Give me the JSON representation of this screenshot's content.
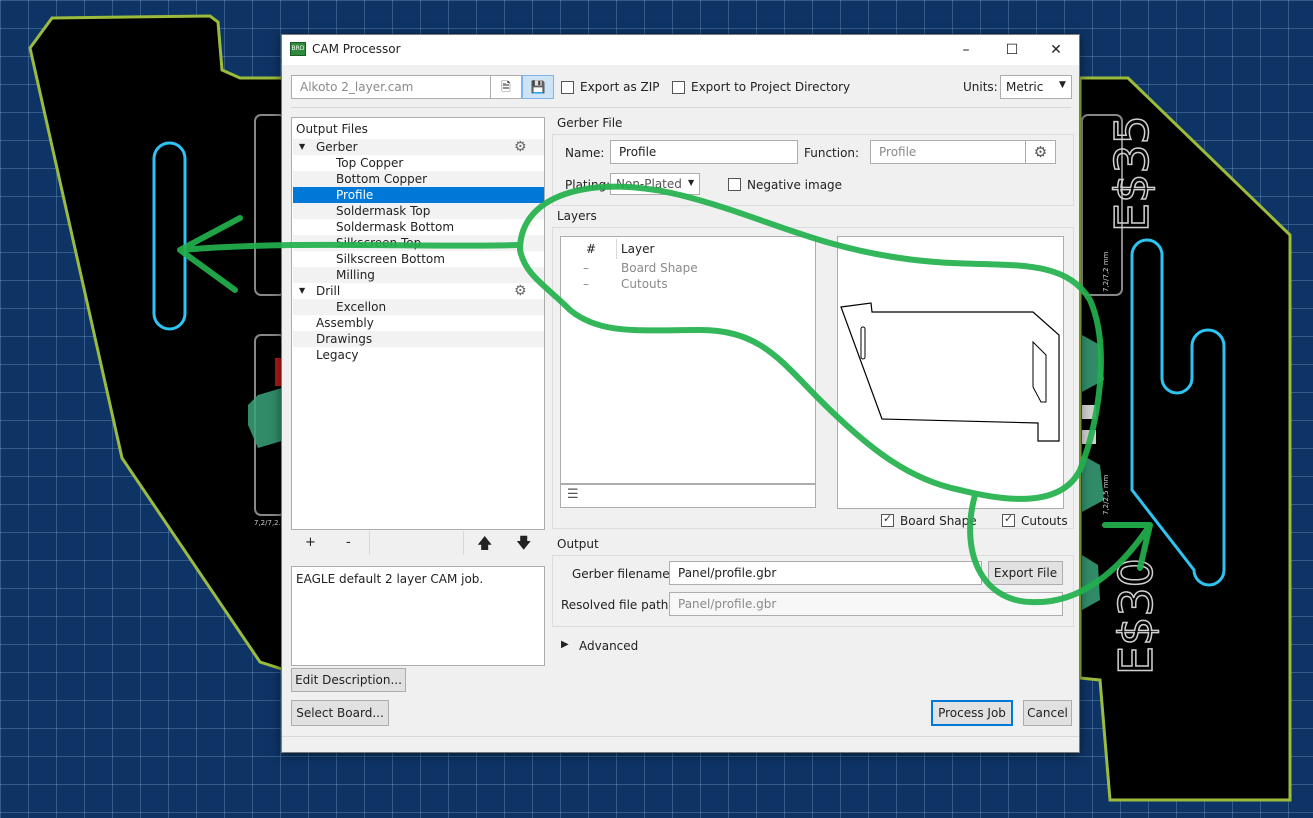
{
  "window": {
    "title": "CAM Processor",
    "minimize": "–",
    "maximize": "☐",
    "close": "✕"
  },
  "toolbar": {
    "job_file": "Alkoto 2_layer.cam",
    "export_zip": "Export as ZIP",
    "export_project_dir": "Export to Project Directory",
    "units_label": "Units:",
    "units_value": "Metric"
  },
  "output_files": {
    "header": "Output Files",
    "groups": {
      "gerber": "Gerber",
      "gerber_items": [
        "Top Copper",
        "Bottom Copper",
        "Profile",
        "Soldermask Top",
        "Soldermask Bottom",
        "Silkscreen Top",
        "Silkscreen Bottom",
        "Milling"
      ],
      "drill": "Drill",
      "drill_items": [
        "Excellon"
      ],
      "other": [
        "Assembly",
        "Drawings",
        "Legacy"
      ]
    },
    "buttons": {
      "add": "+",
      "remove": "-",
      "up": "🡅",
      "down": "🡇"
    }
  },
  "description": "EAGLE default 2 layer CAM job.",
  "buttons": {
    "edit_description": "Edit Description...",
    "select_board": "Select Board...",
    "process_job": "Process Job",
    "cancel": "Cancel",
    "export_file": "Export File"
  },
  "gerber_file": {
    "section": "Gerber File",
    "name_label": "Name:",
    "name_value": "Profile",
    "function_label": "Function:",
    "function_value": "Profile",
    "plating_label": "Plating:",
    "plating_value": "Non-Plated",
    "negative_image": "Negative image"
  },
  "layers": {
    "section": "Layers",
    "col_num": "#",
    "col_layer": "Layer",
    "rows": [
      {
        "num": "–",
        "name": "Board Shape"
      },
      {
        "num": "–",
        "name": "Cutouts"
      }
    ],
    "board_shape_check": "Board Shape",
    "cutouts_check": "Cutouts"
  },
  "output": {
    "section": "Output",
    "gerber_filename_label": "Gerber filename:",
    "gerber_filename": "Panel/profile.gbr",
    "resolved_label": "Resolved file path:",
    "resolved_path": "Panel/profile.gbr"
  },
  "advanced": "Advanced",
  "board_labels": {
    "left": "E$35",
    "right": "E$30",
    "dims_a": "7,2/7,2 mm",
    "dims_b": "7,2/2,5 mm",
    "dims_c": "7,2/7,2..."
  },
  "colors": {
    "background": "#0e3465",
    "board_outline": "#9bbb3c",
    "slot": "#2ec4f2",
    "annotation_green": "#22b14c",
    "selection": "#0078d7"
  }
}
